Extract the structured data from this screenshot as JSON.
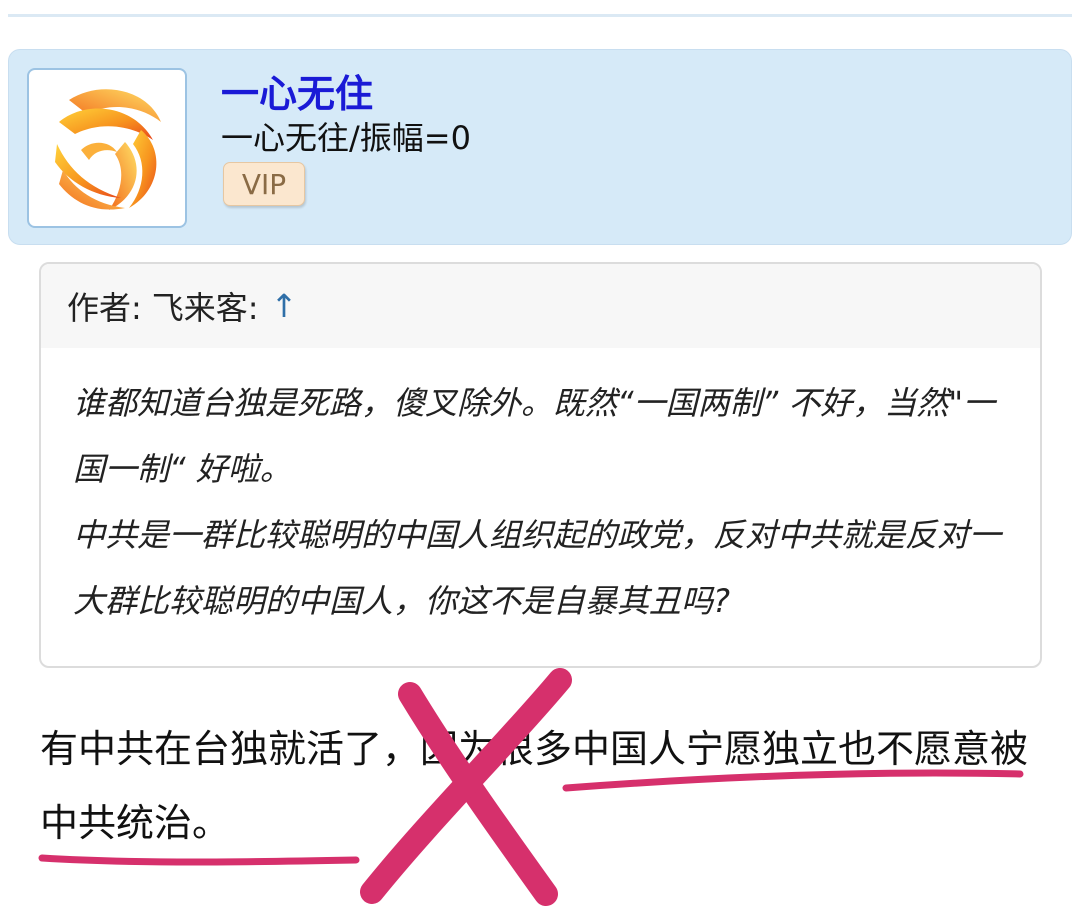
{
  "post": {
    "user": {
      "name": "一心无住",
      "signature": "一心无往/振幅=0",
      "badge": "VIP"
    },
    "quote": {
      "author_label": "作者:",
      "author_name": "飞来客:",
      "jump_icon": "↑",
      "paragraphs": [
        "谁都知道台独是死路，傻叉除外。既然“一国两制” 不好，当然\"一国一制“ 好啦。",
        "中共是一群比较聪明的中国人组织起的政党，反对中共就是反对一大群比较聪明的中国人，你这不是自暴其丑吗?"
      ]
    },
    "reply": {
      "text": "有中共在台独就活了，因为很多中国人宁愿独立也不愿意被中共统治。"
    }
  },
  "annotation": {
    "color": "#d6306c",
    "marks": [
      "x-mark",
      "underline-1",
      "underline-2"
    ]
  },
  "icons": {
    "avatar": "phoenix-logo-icon",
    "jump": "up-arrow-icon"
  }
}
